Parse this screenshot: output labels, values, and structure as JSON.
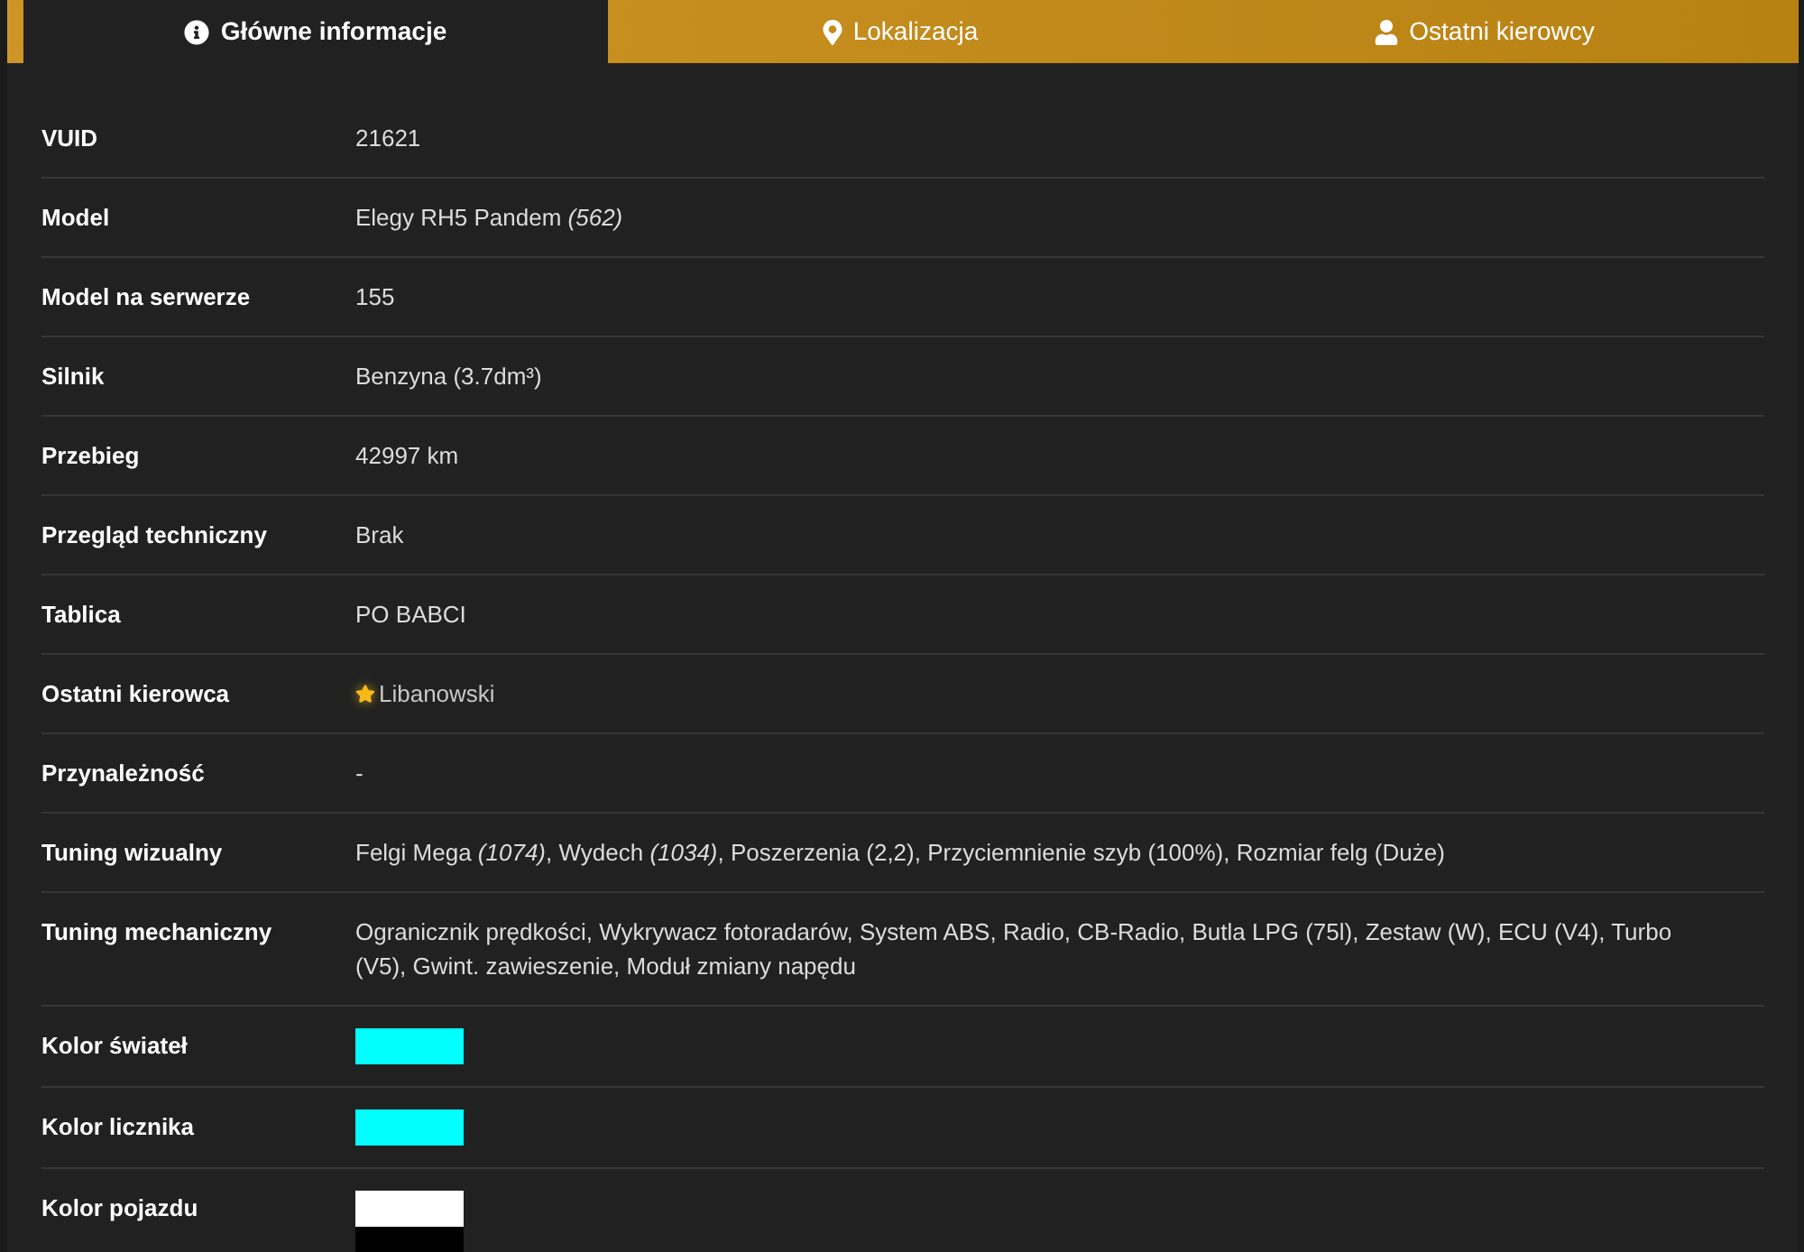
{
  "tabs": [
    {
      "label": "Główne informacje",
      "selected": true
    },
    {
      "label": "Lokalizacja",
      "selected": false
    },
    {
      "label": "Ostatni kierowcy",
      "selected": false
    }
  ],
  "rows": [
    {
      "label": "VUID",
      "value": {
        "kind": "text",
        "text": "21621"
      }
    },
    {
      "label": "Model",
      "value": {
        "kind": "text",
        "text": "Elegy RH5 Pandem *(562)*"
      }
    },
    {
      "label": "Model na serwerze",
      "value": {
        "kind": "text",
        "text": "155"
      }
    },
    {
      "label": "Silnik",
      "value": {
        "kind": "text",
        "text": "Benzyna (3.7dm³)"
      }
    },
    {
      "label": "Przebieg",
      "value": {
        "kind": "text",
        "text": "42997 km"
      }
    },
    {
      "label": "Przegląd techniczny",
      "value": {
        "kind": "text",
        "text": "Brak"
      }
    },
    {
      "label": "Tablica",
      "value": {
        "kind": "text",
        "text": "PO BABCI"
      }
    },
    {
      "label": "Ostatni kierowca",
      "value": {
        "kind": "driver",
        "text": "Libanowski",
        "starred": true
      }
    },
    {
      "label": "Przynależność",
      "value": {
        "kind": "text",
        "text": "-"
      }
    },
    {
      "label": "Tuning wizualny",
      "value": {
        "kind": "text",
        "text": "Felgi Mega *(1074)*, Wydech *(1034)*, Poszerzenia (2,2), Przyciemnienie szyb (100%), Rozmiar felg (Duże)"
      }
    },
    {
      "label": "Tuning mechaniczny",
      "value": {
        "kind": "text",
        "text": "Ogranicznik prędkości, Wykrywacz fotoradarów, System ABS, Radio, CB-Radio, Butla LPG (75l), Zestaw (W), ECU (V4), Turbo (V5), Gwint. zawieszenie, Moduł zmiany napędu"
      }
    },
    {
      "label": "Kolor świateł",
      "value": {
        "kind": "colors",
        "colors": [
          {
            "color": "#00ffff"
          }
        ]
      }
    },
    {
      "label": "Kolor licznika",
      "value": {
        "kind": "colors",
        "colors": [
          {
            "color": "#00ffff"
          }
        ]
      }
    },
    {
      "label": "Kolor pojazdu",
      "value": {
        "kind": "colors",
        "colors": [
          {
            "color": "#ffffff"
          },
          {
            "color": "#000000"
          }
        ]
      }
    }
  ]
}
